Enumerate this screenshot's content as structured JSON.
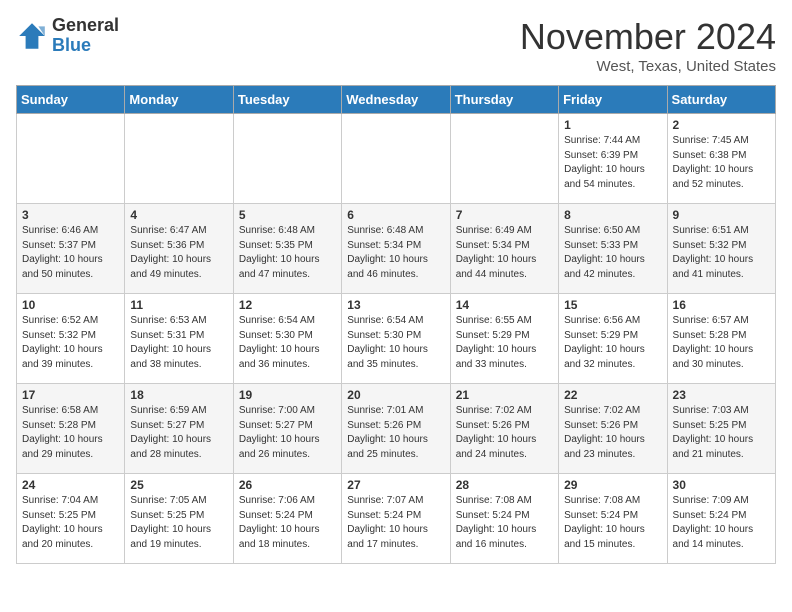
{
  "header": {
    "logo_general": "General",
    "logo_blue": "Blue",
    "month": "November 2024",
    "location": "West, Texas, United States"
  },
  "days_of_week": [
    "Sunday",
    "Monday",
    "Tuesday",
    "Wednesday",
    "Thursday",
    "Friday",
    "Saturday"
  ],
  "weeks": [
    [
      {
        "day": "",
        "info": ""
      },
      {
        "day": "",
        "info": ""
      },
      {
        "day": "",
        "info": ""
      },
      {
        "day": "",
        "info": ""
      },
      {
        "day": "",
        "info": ""
      },
      {
        "day": "1",
        "info": "Sunrise: 7:44 AM\nSunset: 6:39 PM\nDaylight: 10 hours and 54 minutes."
      },
      {
        "day": "2",
        "info": "Sunrise: 7:45 AM\nSunset: 6:38 PM\nDaylight: 10 hours and 52 minutes."
      }
    ],
    [
      {
        "day": "3",
        "info": "Sunrise: 6:46 AM\nSunset: 5:37 PM\nDaylight: 10 hours and 50 minutes."
      },
      {
        "day": "4",
        "info": "Sunrise: 6:47 AM\nSunset: 5:36 PM\nDaylight: 10 hours and 49 minutes."
      },
      {
        "day": "5",
        "info": "Sunrise: 6:48 AM\nSunset: 5:35 PM\nDaylight: 10 hours and 47 minutes."
      },
      {
        "day": "6",
        "info": "Sunrise: 6:48 AM\nSunset: 5:34 PM\nDaylight: 10 hours and 46 minutes."
      },
      {
        "day": "7",
        "info": "Sunrise: 6:49 AM\nSunset: 5:34 PM\nDaylight: 10 hours and 44 minutes."
      },
      {
        "day": "8",
        "info": "Sunrise: 6:50 AM\nSunset: 5:33 PM\nDaylight: 10 hours and 42 minutes."
      },
      {
        "day": "9",
        "info": "Sunrise: 6:51 AM\nSunset: 5:32 PM\nDaylight: 10 hours and 41 minutes."
      }
    ],
    [
      {
        "day": "10",
        "info": "Sunrise: 6:52 AM\nSunset: 5:32 PM\nDaylight: 10 hours and 39 minutes."
      },
      {
        "day": "11",
        "info": "Sunrise: 6:53 AM\nSunset: 5:31 PM\nDaylight: 10 hours and 38 minutes."
      },
      {
        "day": "12",
        "info": "Sunrise: 6:54 AM\nSunset: 5:30 PM\nDaylight: 10 hours and 36 minutes."
      },
      {
        "day": "13",
        "info": "Sunrise: 6:54 AM\nSunset: 5:30 PM\nDaylight: 10 hours and 35 minutes."
      },
      {
        "day": "14",
        "info": "Sunrise: 6:55 AM\nSunset: 5:29 PM\nDaylight: 10 hours and 33 minutes."
      },
      {
        "day": "15",
        "info": "Sunrise: 6:56 AM\nSunset: 5:29 PM\nDaylight: 10 hours and 32 minutes."
      },
      {
        "day": "16",
        "info": "Sunrise: 6:57 AM\nSunset: 5:28 PM\nDaylight: 10 hours and 30 minutes."
      }
    ],
    [
      {
        "day": "17",
        "info": "Sunrise: 6:58 AM\nSunset: 5:28 PM\nDaylight: 10 hours and 29 minutes."
      },
      {
        "day": "18",
        "info": "Sunrise: 6:59 AM\nSunset: 5:27 PM\nDaylight: 10 hours and 28 minutes."
      },
      {
        "day": "19",
        "info": "Sunrise: 7:00 AM\nSunset: 5:27 PM\nDaylight: 10 hours and 26 minutes."
      },
      {
        "day": "20",
        "info": "Sunrise: 7:01 AM\nSunset: 5:26 PM\nDaylight: 10 hours and 25 minutes."
      },
      {
        "day": "21",
        "info": "Sunrise: 7:02 AM\nSunset: 5:26 PM\nDaylight: 10 hours and 24 minutes."
      },
      {
        "day": "22",
        "info": "Sunrise: 7:02 AM\nSunset: 5:26 PM\nDaylight: 10 hours and 23 minutes."
      },
      {
        "day": "23",
        "info": "Sunrise: 7:03 AM\nSunset: 5:25 PM\nDaylight: 10 hours and 21 minutes."
      }
    ],
    [
      {
        "day": "24",
        "info": "Sunrise: 7:04 AM\nSunset: 5:25 PM\nDaylight: 10 hours and 20 minutes."
      },
      {
        "day": "25",
        "info": "Sunrise: 7:05 AM\nSunset: 5:25 PM\nDaylight: 10 hours and 19 minutes."
      },
      {
        "day": "26",
        "info": "Sunrise: 7:06 AM\nSunset: 5:24 PM\nDaylight: 10 hours and 18 minutes."
      },
      {
        "day": "27",
        "info": "Sunrise: 7:07 AM\nSunset: 5:24 PM\nDaylight: 10 hours and 17 minutes."
      },
      {
        "day": "28",
        "info": "Sunrise: 7:08 AM\nSunset: 5:24 PM\nDaylight: 10 hours and 16 minutes."
      },
      {
        "day": "29",
        "info": "Sunrise: 7:08 AM\nSunset: 5:24 PM\nDaylight: 10 hours and 15 minutes."
      },
      {
        "day": "30",
        "info": "Sunrise: 7:09 AM\nSunset: 5:24 PM\nDaylight: 10 hours and 14 minutes."
      }
    ]
  ]
}
